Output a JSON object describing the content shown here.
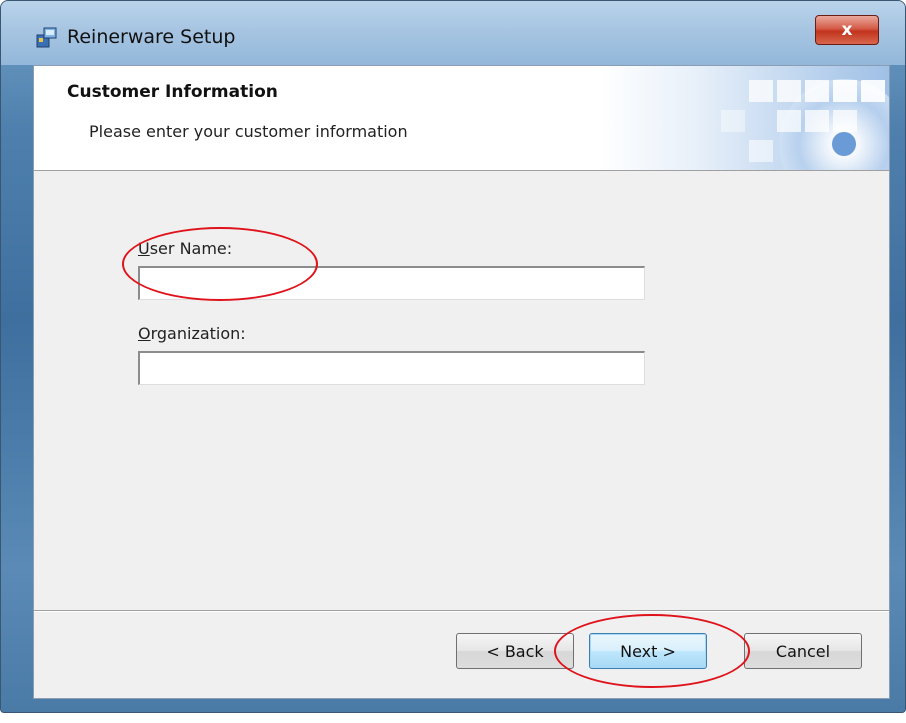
{
  "window": {
    "title": "Reinerware Setup",
    "close_label": "x"
  },
  "banner": {
    "title": "Customer Information",
    "subtitle": "Please enter your customer information"
  },
  "form": {
    "user_name": {
      "label_underlined": "U",
      "label_rest": "ser Name:",
      "value": ""
    },
    "organization": {
      "label_underlined": "O",
      "label_rest": "rganization:",
      "value": ""
    }
  },
  "buttons": {
    "back": "< Back",
    "next": "Next >",
    "cancel": "Cancel"
  },
  "colors": {
    "annotation": "#e0121b",
    "default_button_border": "#3c7fb1",
    "close_button": "#c2331d"
  }
}
